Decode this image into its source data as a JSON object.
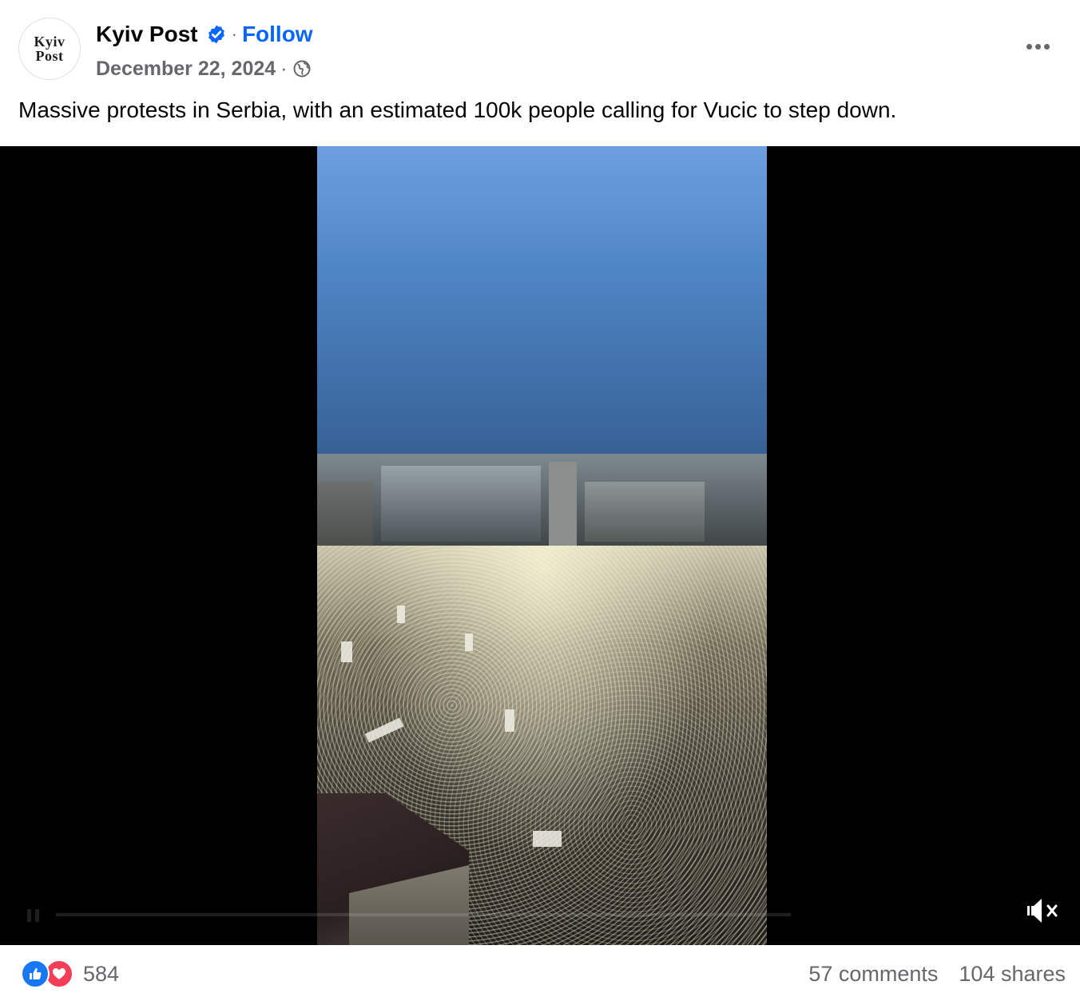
{
  "post": {
    "author": "Kyiv Post",
    "avatar_text": [
      "Kyiv",
      "Post"
    ],
    "follow_label": "Follow",
    "date": "December 22, 2024",
    "audience": "globe-icon",
    "caption": "Massive protests in Serbia, with an estimated 100k people calling for Vucic to step down."
  },
  "video": {
    "muted": true
  },
  "footer": {
    "reaction_count": "584",
    "comments": "57 comments",
    "shares": "104 shares"
  },
  "colors": {
    "link": "#0866ff",
    "secondary_text": "#65676b",
    "like": "#1877f2",
    "love": "#f33e58"
  }
}
